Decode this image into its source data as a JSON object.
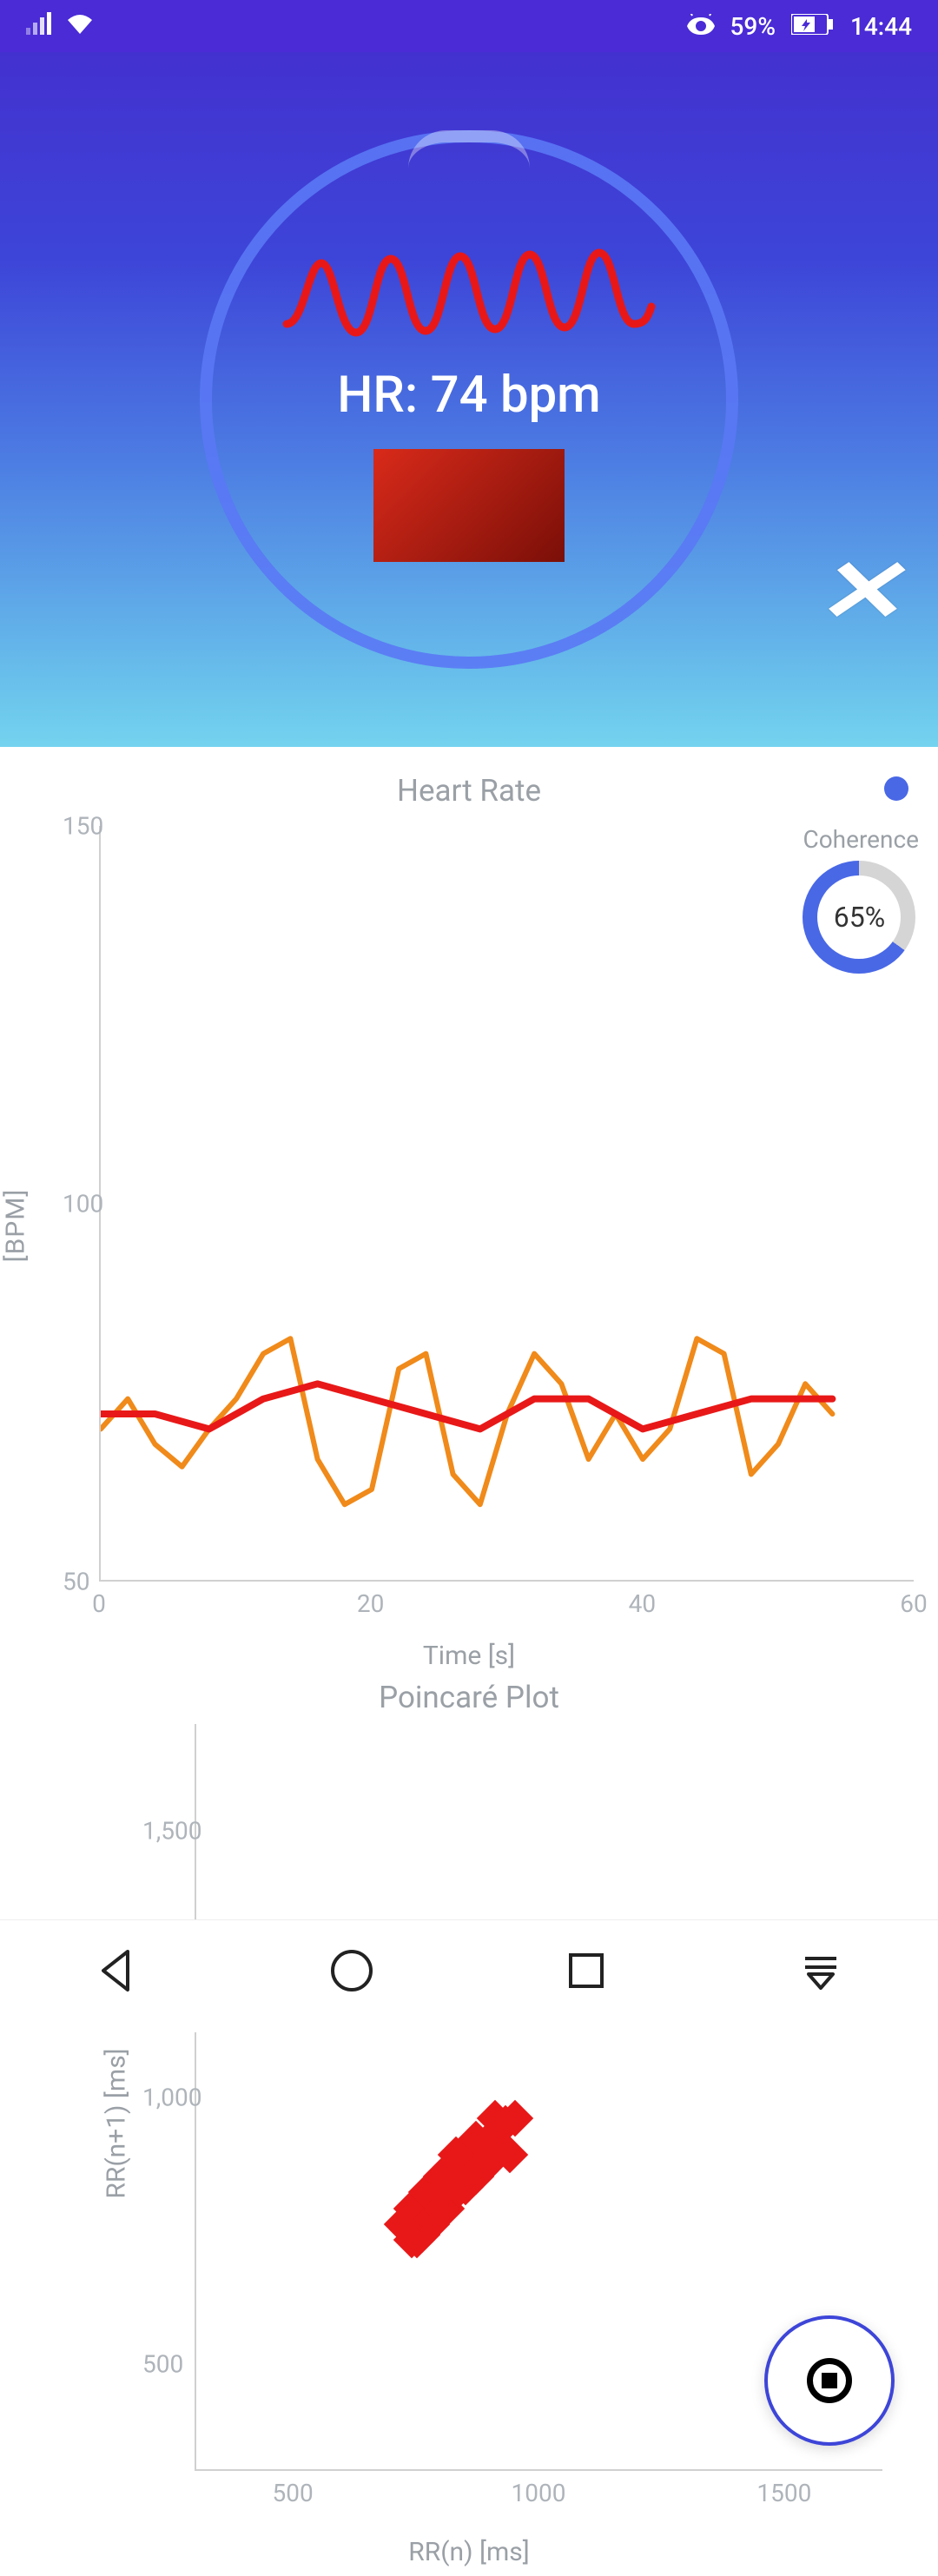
{
  "status_bar": {
    "battery_pct": "59%",
    "time": "14:44"
  },
  "hero": {
    "hr_label": "HR: 74 bpm"
  },
  "coherence": {
    "label": "Coherence",
    "value": "65%",
    "pct_numeric": 65
  },
  "chart_data": [
    {
      "type": "line",
      "title": "Heart Rate",
      "xlabel": "Time [s]",
      "ylabel": "[BPM]",
      "xlim": [
        0,
        60
      ],
      "ylim": [
        50,
        150
      ],
      "x_ticks": [
        0,
        20,
        40,
        60
      ],
      "y_ticks": [
        50,
        100,
        150
      ],
      "series": [
        {
          "name": "instant",
          "color": "#f08a1a",
          "x": [
            0,
            2,
            4,
            6,
            8,
            10,
            12,
            14,
            16,
            18,
            20,
            22,
            24,
            26,
            28,
            30,
            32,
            34,
            36,
            38,
            40,
            42,
            44,
            46,
            48,
            50,
            52,
            54
          ],
          "values": [
            70,
            74,
            68,
            65,
            70,
            74,
            80,
            82,
            66,
            60,
            62,
            78,
            80,
            64,
            60,
            72,
            80,
            76,
            66,
            72,
            66,
            70,
            82,
            80,
            64,
            68,
            76,
            72
          ]
        },
        {
          "name": "smoothed",
          "color": "#e81818",
          "x": [
            0,
            4,
            8,
            12,
            16,
            20,
            24,
            28,
            32,
            36,
            40,
            44,
            48,
            52,
            54
          ],
          "values": [
            72,
            72,
            70,
            74,
            76,
            74,
            72,
            70,
            74,
            74,
            70,
            72,
            74,
            74,
            74
          ]
        }
      ]
    },
    {
      "type": "scatter",
      "title": "Poincaré Plot",
      "xlabel": "RR(n) [ms]",
      "ylabel": "RR(n+1) [ms]",
      "xlim": [
        300,
        1700
      ],
      "ylim": [
        300,
        1700
      ],
      "x_ticks": [
        500,
        1000,
        1500
      ],
      "y_ticks": [
        500,
        1000,
        1500
      ],
      "points": [
        [
          740,
          730
        ],
        [
          760,
          740
        ],
        [
          750,
          770
        ],
        [
          770,
          760
        ],
        [
          780,
          790
        ],
        [
          790,
          800
        ],
        [
          800,
          810
        ],
        [
          810,
          790
        ],
        [
          820,
          830
        ],
        [
          830,
          840
        ],
        [
          840,
          860
        ],
        [
          860,
          870
        ],
        [
          870,
          880
        ],
        [
          880,
          900
        ],
        [
          900,
          910
        ],
        [
          910,
          930
        ],
        [
          930,
          950
        ],
        [
          950,
          960
        ],
        [
          760,
          780
        ],
        [
          770,
          790
        ],
        [
          790,
          780
        ],
        [
          800,
          820
        ],
        [
          810,
          830
        ],
        [
          820,
          810
        ],
        [
          830,
          860
        ],
        [
          840,
          830
        ],
        [
          860,
          890
        ],
        [
          870,
          850
        ],
        [
          880,
          910
        ],
        [
          900,
          880
        ],
        [
          730,
          750
        ],
        [
          750,
          730
        ],
        [
          760,
          800
        ],
        [
          780,
          760
        ],
        [
          790,
          830
        ],
        [
          810,
          850
        ],
        [
          840,
          880
        ],
        [
          870,
          920
        ],
        [
          910,
          960
        ],
        [
          940,
          890
        ],
        [
          720,
          760
        ],
        [
          740,
          790
        ],
        [
          770,
          820
        ],
        [
          800,
          850
        ],
        [
          830,
          890
        ],
        [
          850,
          830
        ],
        [
          880,
          860
        ],
        [
          920,
          940
        ],
        [
          780,
          770
        ],
        [
          800,
          790
        ]
      ]
    }
  ]
}
